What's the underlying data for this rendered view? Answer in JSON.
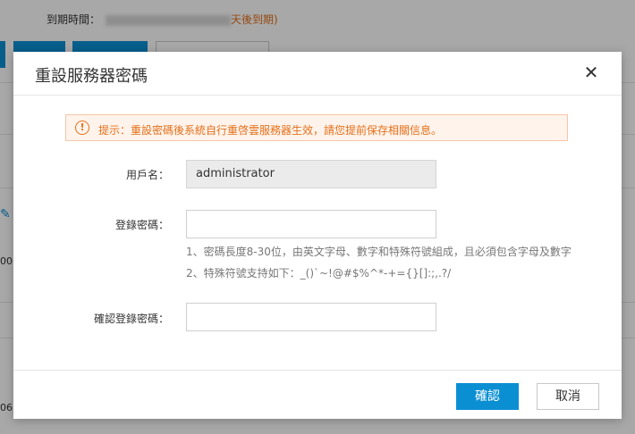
{
  "background": {
    "expire_label": "到期時間：",
    "expire_suffix": "天後到期)",
    "fragment_a": "00",
    "fragment_b": "06"
  },
  "dialog": {
    "title": "重設服務器密碼",
    "close_symbol": "✕",
    "alert": {
      "icon_symbol": "!",
      "text": "提示：重設密碼後系統自行重啓雲服務器生效，請您提前保存相關信息。"
    },
    "fields": {
      "username_label": "用戶名：",
      "username_value": "administrator",
      "password_label": "登錄密碼：",
      "password_value": "",
      "confirm_label": "確認登錄密碼：",
      "confirm_value": ""
    },
    "hints": {
      "line1": "1、密碼長度8-30位，由英文字母、數字和特殊符號組成，且必須包含字母及數字",
      "line2": "2、特殊符號支持如下：_()`~!@#$%^*-+={}[]:;,.?/"
    },
    "buttons": {
      "confirm": "確認",
      "cancel": "取消"
    }
  },
  "colors": {
    "accent": "#0b8fd3",
    "warning": "#e3701a",
    "warning_bg": "#fff3eb"
  }
}
